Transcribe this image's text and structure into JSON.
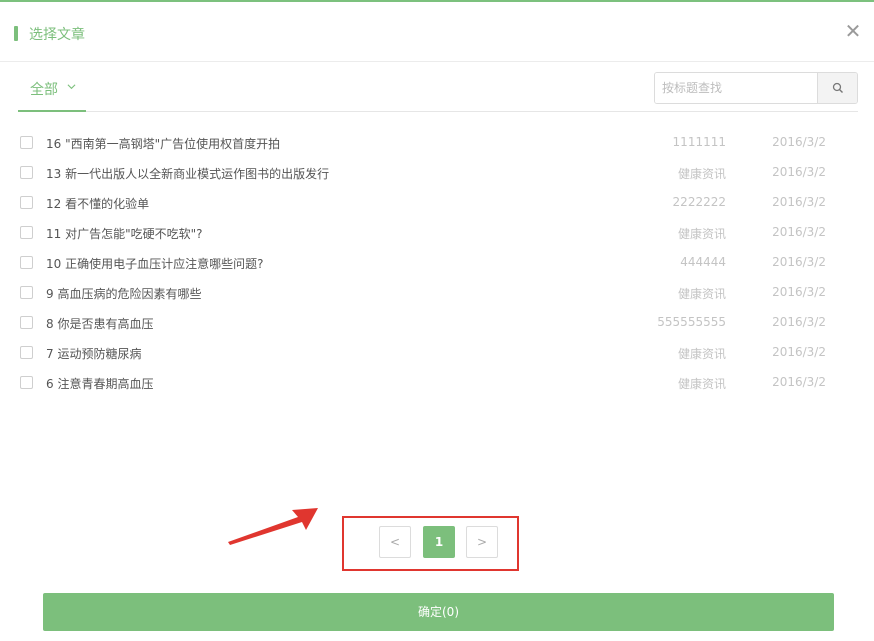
{
  "dialog": {
    "title": "选择文章",
    "close_icon": "close-icon",
    "accent_color": "#7cbf7c"
  },
  "filter": {
    "tab_label": "全部",
    "search_placeholder": "按标题查找",
    "search_value": ""
  },
  "articles": [
    {
      "title": "16 \"西南第一高钢塔\"广告位使用权首度开拍",
      "source": "1111111",
      "date": "2016/3/2"
    },
    {
      "title": "13 新一代出版人以全新商业模式运作图书的出版发行",
      "source": "健康资讯",
      "date": "2016/3/2"
    },
    {
      "title": "12 看不懂的化验单",
      "source": "2222222",
      "date": "2016/3/2"
    },
    {
      "title": "11 对广告怎能\"吃硬不吃软\"?",
      "source": "健康资讯",
      "date": "2016/3/2"
    },
    {
      "title": "10 正确使用电子血压计应注意哪些问题?",
      "source": "444444",
      "date": "2016/3/2"
    },
    {
      "title": "9 高血压病的危险因素有哪些",
      "source": "健康资讯",
      "date": "2016/3/2"
    },
    {
      "title": "8 你是否患有高血压",
      "source": "555555555",
      "date": "2016/3/2"
    },
    {
      "title": "7 运动预防糖尿病",
      "source": "健康资讯",
      "date": "2016/3/2"
    },
    {
      "title": "6 注意青春期高血压",
      "source": "健康资讯",
      "date": "2016/3/2"
    }
  ],
  "pagination": {
    "prev": "<",
    "current": "1",
    "next": ">"
  },
  "footer": {
    "confirm_label": "确定(0)"
  },
  "annotation": {
    "highlight_color": "#e0362f"
  }
}
